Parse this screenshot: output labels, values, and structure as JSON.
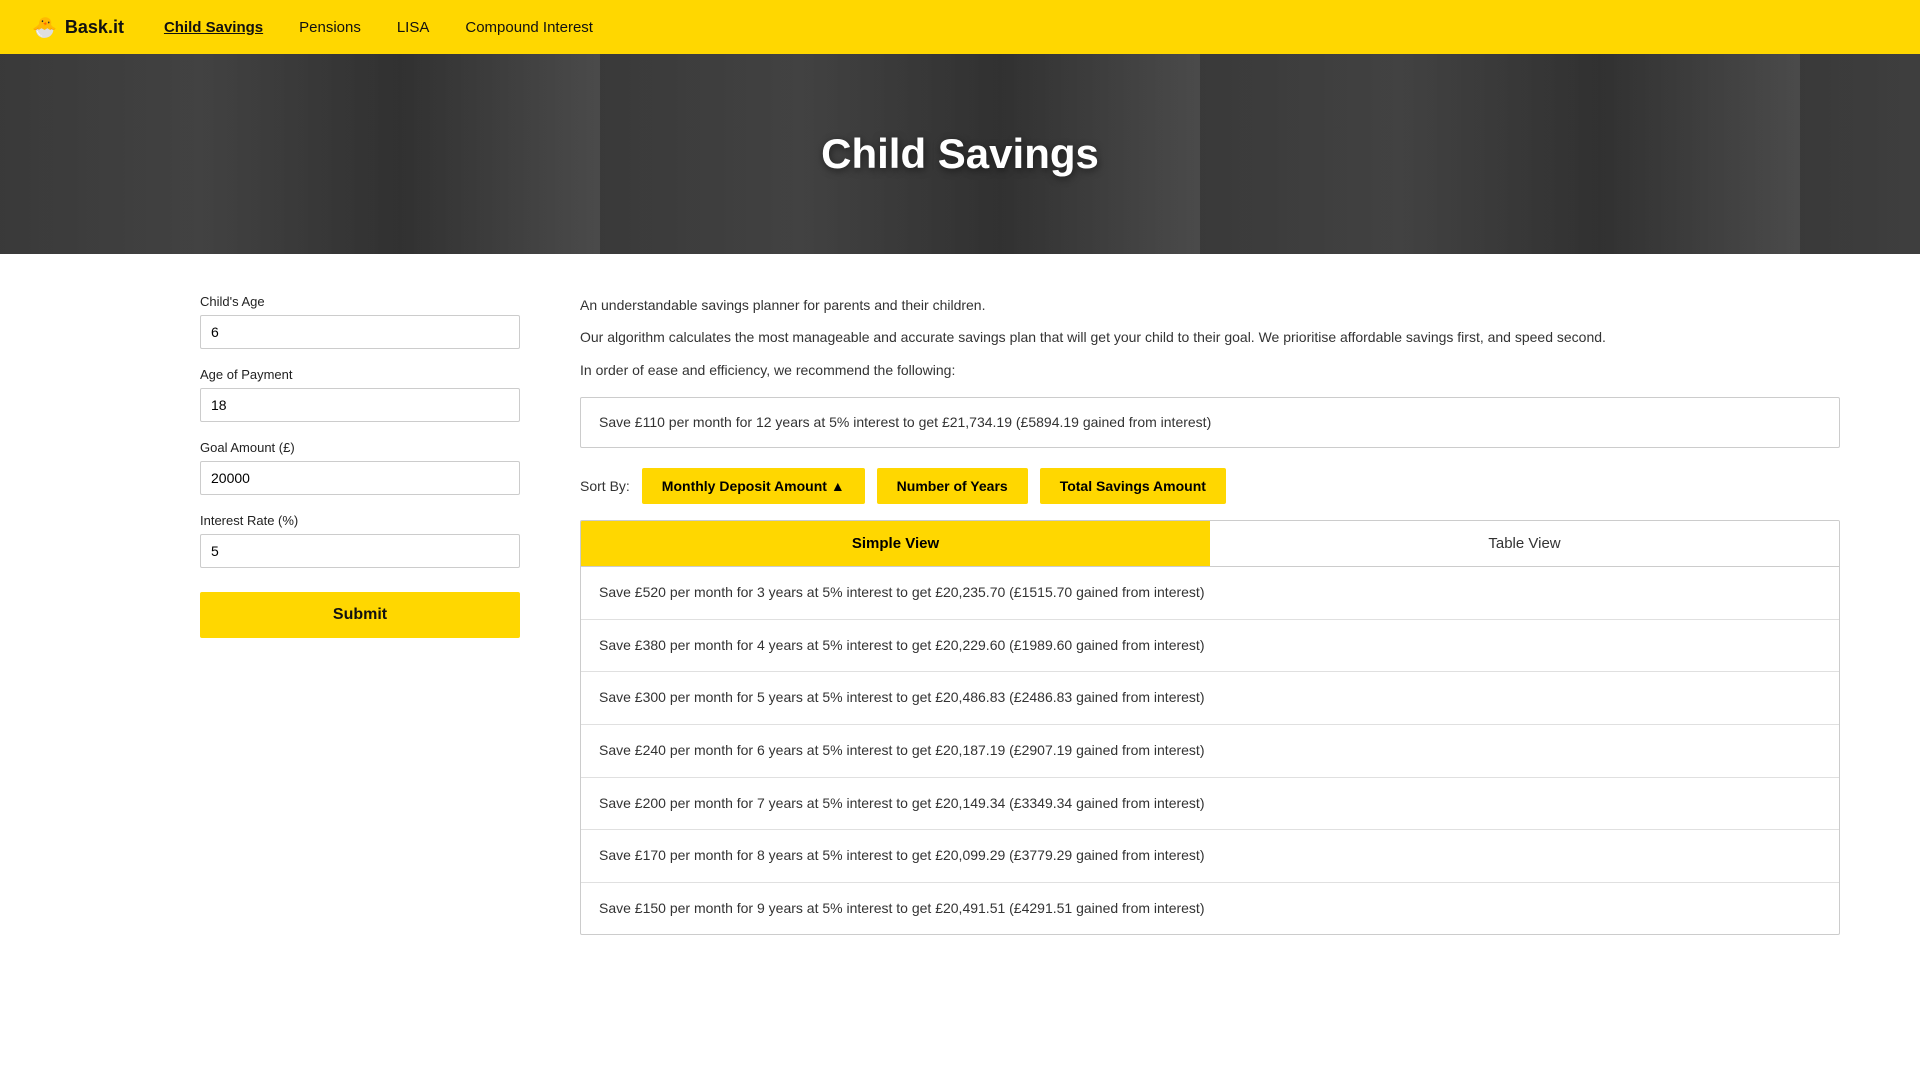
{
  "brand": {
    "logo_text": "Bask.it",
    "logo_icon": "🐣"
  },
  "nav": {
    "links": [
      {
        "label": "Child Savings",
        "active": true
      },
      {
        "label": "Pensions",
        "active": false
      },
      {
        "label": "LISA",
        "active": false
      },
      {
        "label": "Compound Interest",
        "active": false
      }
    ]
  },
  "hero": {
    "title": "Child Savings"
  },
  "form": {
    "fields": [
      {
        "label": "Child's Age",
        "value": "6",
        "placeholder": ""
      },
      {
        "label": "Age of Payment",
        "value": "18",
        "placeholder": ""
      },
      {
        "label": "Goal Amount (£)",
        "value": "20000",
        "placeholder": ""
      },
      {
        "label": "Interest Rate (%)",
        "value": "5",
        "placeholder": ""
      }
    ],
    "submit_label": "Submit"
  },
  "description": {
    "line1": "An understandable savings planner for parents and their children.",
    "line2": "Our algorithm calculates the most manageable and accurate savings plan that will get your child to their goal. We prioritise affordable savings first, and speed second.",
    "line3": "In order of ease and efficiency, we recommend the following:"
  },
  "recommendation": "Save £110 per month for 12 years at 5% interest to get £21,734.19 (£5894.19 gained from interest)",
  "sort_by": {
    "label": "Sort By:",
    "buttons": [
      {
        "label": "Monthly Deposit Amount ▲"
      },
      {
        "label": "Number of Years"
      },
      {
        "label": "Total Savings Amount"
      }
    ]
  },
  "view_tabs": [
    {
      "label": "Simple View",
      "active": true
    },
    {
      "label": "Table View",
      "active": false
    }
  ],
  "results": [
    "Save £520 per month for 3 years at 5% interest to get £20,235.70 (£1515.70 gained from interest)",
    "Save £380 per month for 4 years at 5% interest to get £20,229.60 (£1989.60 gained from interest)",
    "Save £300 per month for 5 years at 5% interest to get £20,486.83 (£2486.83 gained from interest)",
    "Save £240 per month for 6 years at 5% interest to get £20,187.19 (£2907.19 gained from interest)",
    "Save £200 per month for 7 years at 5% interest to get £20,149.34 (£3349.34 gained from interest)",
    "Save £170 per month for 8 years at 5% interest to get £20,099.29 (£3779.29 gained from interest)",
    "Save £150 per month for 9 years at 5% interest to get £20,491.51 (£4291.51 gained from interest)"
  ]
}
